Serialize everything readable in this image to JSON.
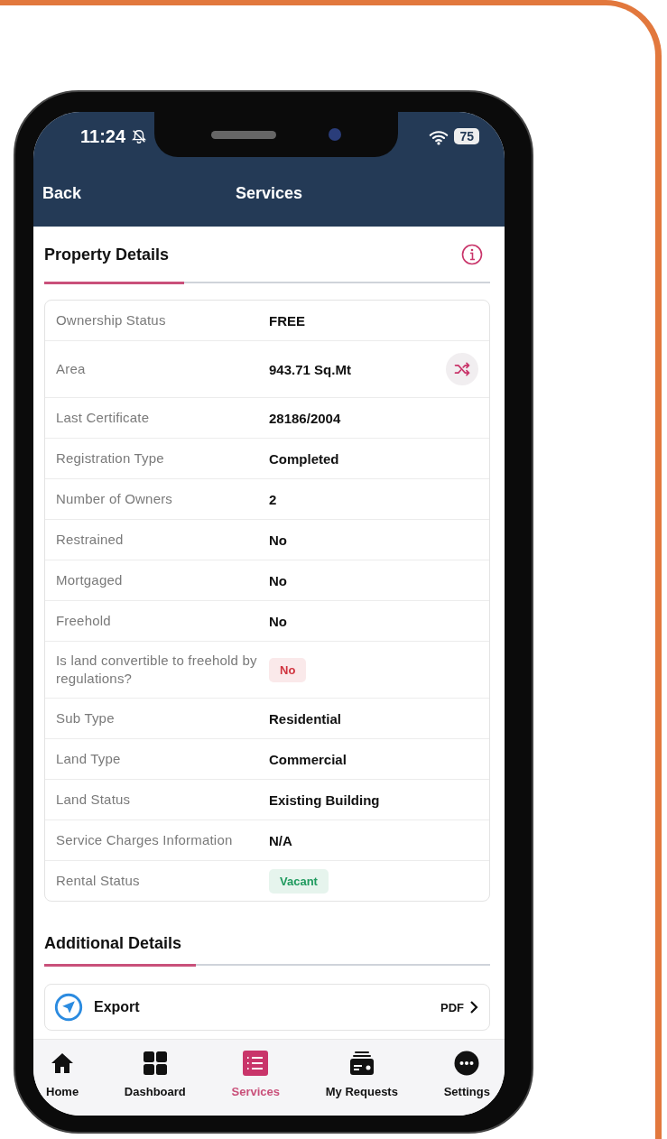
{
  "status_bar": {
    "time": "11:24",
    "battery": "75"
  },
  "nav": {
    "back": "Back",
    "title": "Services"
  },
  "property_details": {
    "title": "Property Details",
    "rows": [
      {
        "label": "Ownership Status",
        "value": "FREE",
        "kind": "text"
      },
      {
        "label": "Area",
        "value": "943.71 Sq.Mt",
        "kind": "text",
        "shuffle_button": true
      },
      {
        "label": "Last Certificate",
        "value": "28186/2004",
        "kind": "text"
      },
      {
        "label": "Registration Type",
        "value": "Completed",
        "kind": "text"
      },
      {
        "label": "Number of Owners",
        "value": "2",
        "kind": "text"
      },
      {
        "label": "Restrained",
        "value": "No",
        "kind": "text"
      },
      {
        "label": "Mortgaged",
        "value": "No",
        "kind": "text"
      },
      {
        "label": "Freehold",
        "value": "No",
        "kind": "text"
      },
      {
        "label": "Is land convertible to freehold by regulations?",
        "value": "No",
        "kind": "badge",
        "color": "#d0343f"
      },
      {
        "label": "Sub Type",
        "value": "Residential",
        "kind": "text"
      },
      {
        "label": "Land Type",
        "value": "Commercial",
        "kind": "text"
      },
      {
        "label": "Land Status",
        "value": "Existing Building",
        "kind": "text"
      },
      {
        "label": "Service Charges Information",
        "value": "N/A",
        "kind": "text"
      },
      {
        "label": "Rental Status",
        "value": "Vacant",
        "kind": "badge",
        "color": "#1f9a5e"
      }
    ]
  },
  "additional_details": {
    "title": "Additional Details",
    "items": [
      {
        "label": "Export",
        "value": "PDF"
      }
    ]
  },
  "tab_bar": [
    {
      "label": "Home",
      "selected": false
    },
    {
      "label": "Dashboard",
      "selected": false
    },
    {
      "label": "Services",
      "selected": true
    },
    {
      "label": "My Requests",
      "selected": false
    },
    {
      "label": "Settings",
      "selected": false
    }
  ]
}
